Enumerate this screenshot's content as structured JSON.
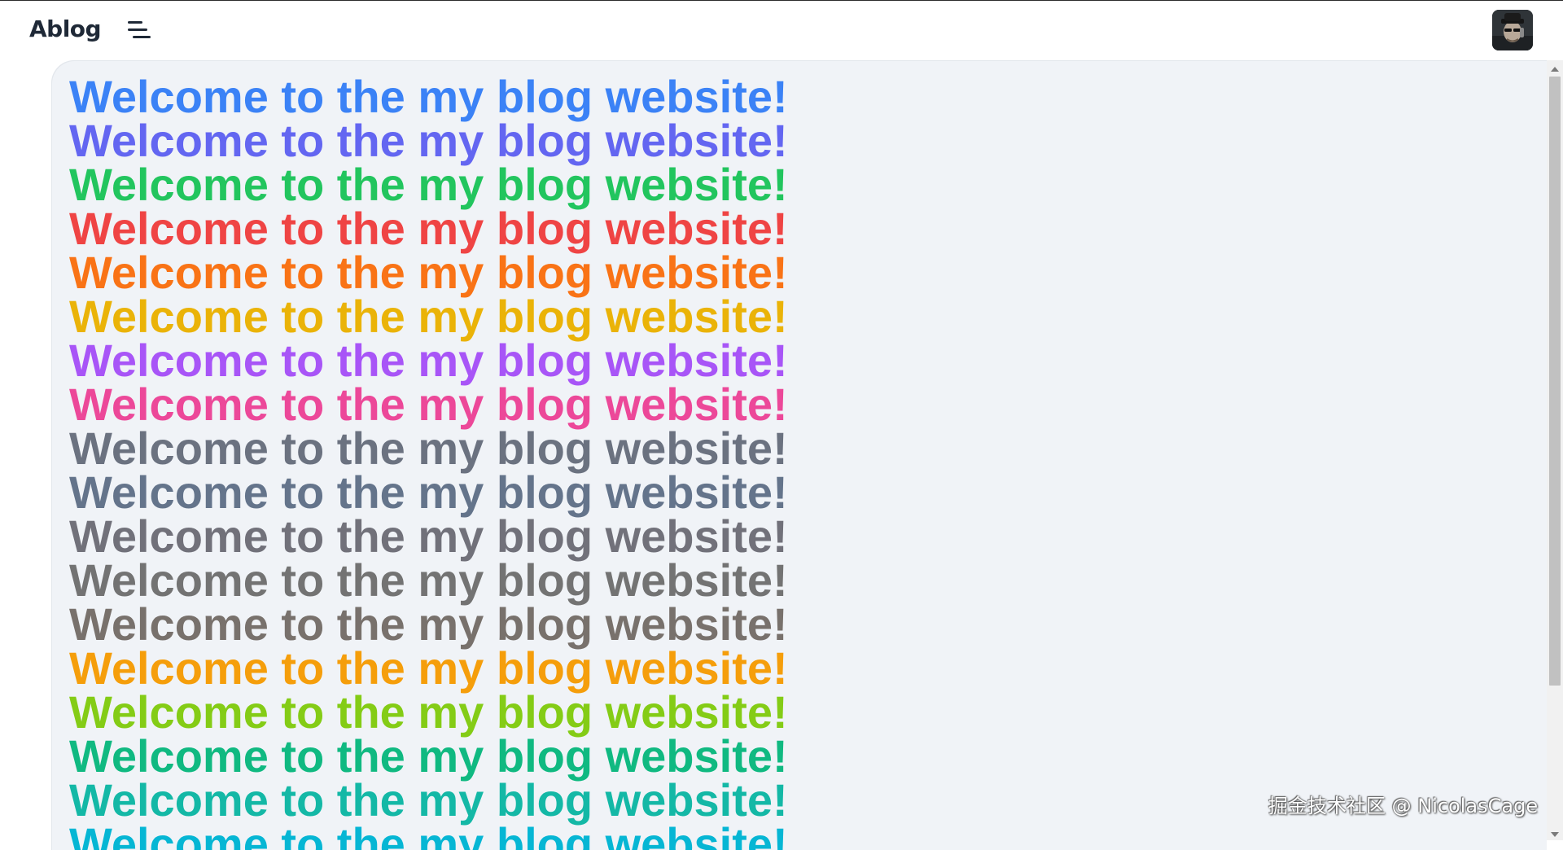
{
  "header": {
    "brand": "Ablog",
    "menu_icon": "menu-fold-icon",
    "avatar_icon": "user-avatar"
  },
  "main": {
    "welcome_text": "Welcome to the my blog website!",
    "line_colors": [
      "#3b82f6",
      "#6366f1",
      "#22c55e",
      "#ef4444",
      "#f97316",
      "#eab308",
      "#a855f7",
      "#ec4899",
      "#6b7280",
      "#64748b",
      "#71717a",
      "#737373",
      "#78716c",
      "#f59e0b",
      "#84cc16",
      "#10b981",
      "#14b8a6",
      "#06b6d4"
    ]
  },
  "watermark": "掘金技术社区 @ NicolasCage"
}
